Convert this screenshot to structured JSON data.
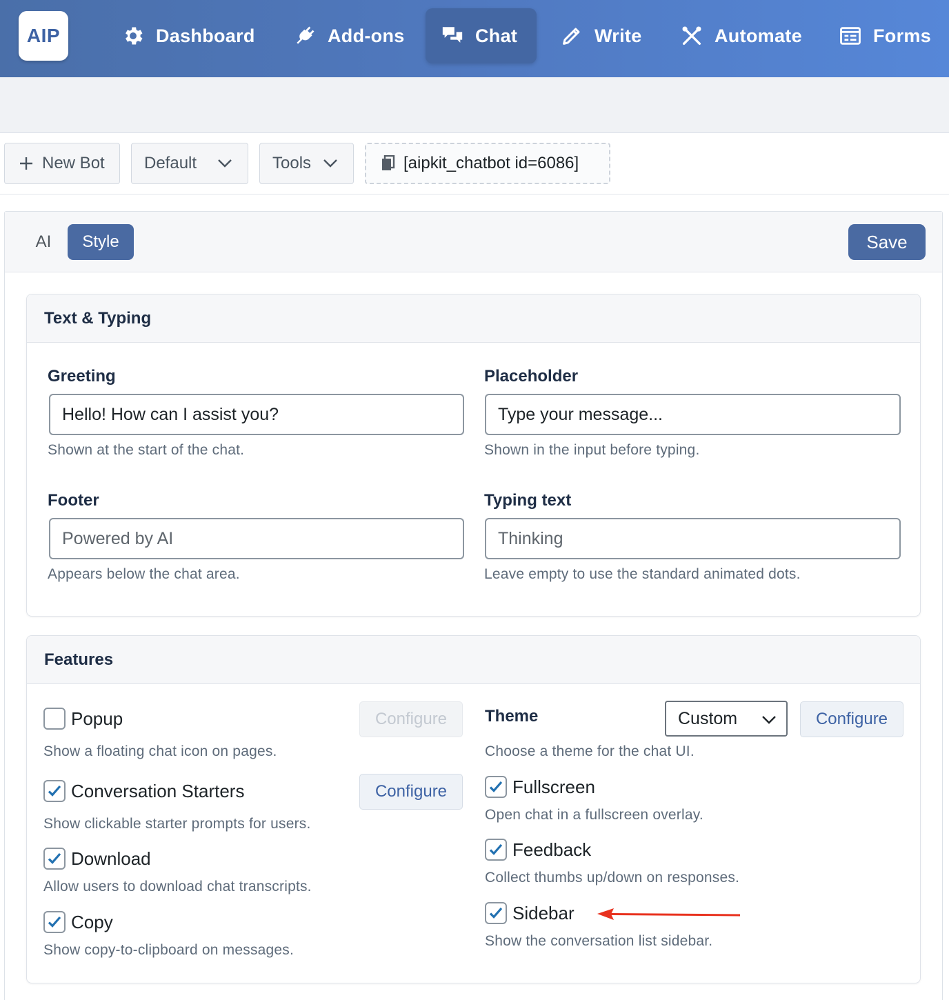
{
  "app": {
    "logo": "AIP",
    "nav": [
      {
        "label": "Dashboard",
        "icon": "gear-icon"
      },
      {
        "label": "Add-ons",
        "icon": "plug-icon"
      },
      {
        "label": "Chat",
        "icon": "chat-bubbles-icon",
        "active": true
      },
      {
        "label": "Write",
        "icon": "pencil-icon"
      },
      {
        "label": "Automate",
        "icon": "tools-icon"
      },
      {
        "label": "Forms",
        "icon": "form-icon"
      }
    ]
  },
  "toolbar": {
    "new_bot": "New Bot",
    "bot_select": "Default",
    "tools": "Tools",
    "shortcode": "[aipkit_chatbot id=6086]"
  },
  "panel": {
    "tabs": [
      {
        "label": "AI",
        "active": false
      },
      {
        "label": "Style",
        "active": true
      }
    ],
    "save": "Save"
  },
  "text_typing": {
    "title": "Text & Typing",
    "greeting": {
      "label": "Greeting",
      "value": "Hello! How can I assist you?",
      "help": "Shown at the start of the chat."
    },
    "placeholder": {
      "label": "Placeholder",
      "value": "Type your message...",
      "help": "Shown in the input before typing."
    },
    "footer": {
      "label": "Footer",
      "placeholder": "Powered by AI",
      "help": "Appears below the chat area."
    },
    "typing": {
      "label": "Typing text",
      "placeholder": "Thinking",
      "help": "Leave empty to use the standard animated dots."
    }
  },
  "features": {
    "title": "Features",
    "popup": {
      "label": "Popup",
      "checked": false,
      "help": "Show a floating chat icon on pages.",
      "configure": "Configure"
    },
    "starters": {
      "label": "Conversation Starters",
      "checked": true,
      "help": "Show clickable starter prompts for users.",
      "configure": "Configure"
    },
    "download": {
      "label": "Download",
      "checked": true,
      "help": "Allow users to download chat transcripts."
    },
    "copy": {
      "label": "Copy",
      "checked": true,
      "help": "Show copy-to-clipboard on messages."
    },
    "theme": {
      "label": "Theme",
      "value": "Custom",
      "help": "Choose a theme for the chat UI.",
      "configure": "Configure"
    },
    "fullscreen": {
      "label": "Fullscreen",
      "checked": true,
      "help": "Open chat in a fullscreen overlay."
    },
    "feedback": {
      "label": "Feedback",
      "checked": true,
      "help": "Collect thumbs up/down on responses."
    },
    "sidebar": {
      "label": "Sidebar",
      "checked": true,
      "help": "Show the conversation list sidebar."
    }
  },
  "colors": {
    "brand": "#4a6aa2",
    "checkbox_check": "#2271b1",
    "annotation_arrow": "#e8321f"
  }
}
